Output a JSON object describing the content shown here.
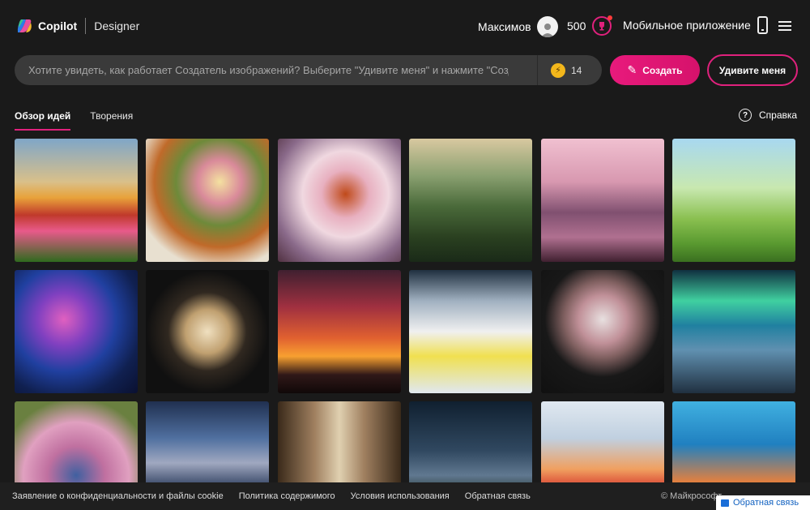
{
  "header": {
    "logo_text": "Copilot",
    "logo_sub": "Designer",
    "user_name": "Максимов",
    "points": "500",
    "mobile_label": "Мобильное приложение"
  },
  "prompt": {
    "placeholder": "Хотите увидеть, как работает Создатель изображений? Выберите \"Удивите меня\" и нажмите \"Создать\"",
    "boosts": "14",
    "create_label": "Создать",
    "surprise_label": "Удивите меня"
  },
  "tabs": [
    {
      "label": "Обзор идей",
      "active": true
    },
    {
      "label": "Творения",
      "active": false
    }
  ],
  "help_label": "Справка",
  "footer": {
    "links": [
      "Заявление о конфиденциальности и файлы cookie",
      "Политика содержимого",
      "Условия использования",
      "Обратная связь"
    ],
    "copyright": "© Майкрософт",
    "feedback_label": "Обратная связь"
  },
  "colors": {
    "accent": "#e0217d",
    "background": "#1a1a1a"
  }
}
